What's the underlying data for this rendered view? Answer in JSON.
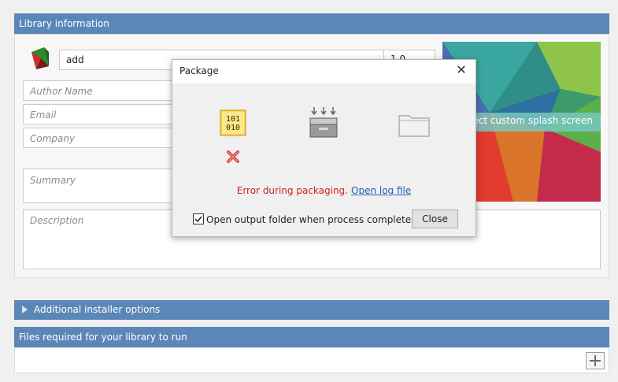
{
  "library_info": {
    "header": "Library information",
    "name_value": "add",
    "version_value": "1.0",
    "author_placeholder": "Author Name",
    "email_placeholder": "Email",
    "company_placeholder": "Company",
    "summary_placeholder": "Summary",
    "description_placeholder": "Description",
    "splash_button": "Select custom splash screen"
  },
  "additional_options": {
    "label": "Additional installer options"
  },
  "files_required": {
    "header": "Files required for your library to run",
    "add_icon": "plus-icon"
  },
  "dialog": {
    "title": "Package",
    "close_glyph": "✕",
    "error_text": "Error during packaging.",
    "log_link": "Open log file",
    "checkbox_label": "Open output folder when process completes",
    "checkbox_checked": true,
    "close_button": "Close",
    "icons": [
      "binary-file-icon",
      "error-x-icon",
      "package-box-icon",
      "folder-icon"
    ]
  },
  "colors": {
    "header_bg": "#5b87b8",
    "error": "#d02020",
    "link": "#1e5fb3"
  }
}
